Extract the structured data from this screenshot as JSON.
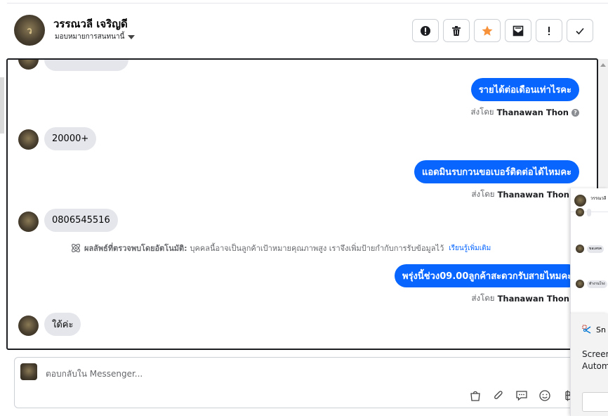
{
  "header": {
    "name": "วรรณวลี เจริญดี",
    "assign_label": "มอบหมายการสนทนานี้",
    "avatar_text": "ว"
  },
  "actions": [
    {
      "name": "mark-spam-button",
      "icon": "alert-circle-icon"
    },
    {
      "name": "delete-button",
      "icon": "trash-icon"
    },
    {
      "name": "star-button",
      "icon": "star-icon"
    },
    {
      "name": "mark-unread-button",
      "icon": "envelope-icon"
    },
    {
      "name": "follow-up-button",
      "icon": "exclamation-icon"
    },
    {
      "name": "mark-done-button",
      "icon": "check-icon"
    }
  ],
  "messages": {
    "top_partial": "...",
    "out_1": "รายได้ต่อเดือนเท่าไรคะ",
    "sent_prefix": "ส่งโดย",
    "sender": "Thanawan Thon",
    "in_1": "20000+",
    "out_2": "แอดมินรบกวนขอเบอร์ติดต่อได้ไหมคะ",
    "in_2": "0806545516",
    "out_3": "พรุ่งนี้ช่วง09.00ลูกค้าสะดวกรับสายไหมคะ",
    "in_3": "ใด้ค่ะ"
  },
  "ai_note": {
    "title": "ผลลัพธ์ที่ตรวจพบโดยอัตโนมัติ:",
    "text": "บุคคลนี้อาจเป็นลูกค้าเป้าหมายคุณภาพสูง เราจึงเพิ่มป้ายกำกับการรับข้อมูลไว้",
    "learn_more": "เรียนรู้เพิ่มเติม"
  },
  "reply": {
    "placeholder": "ตอบกลับใน Messenger..."
  },
  "mini_panel": {
    "name": "วรรณวลี",
    "items": [
      "",
      "ขอเลขค",
      "ทำงานโรง"
    ]
  },
  "snip": {
    "title": "Sn",
    "line1": "Screer",
    "line2": "Autom"
  },
  "colors": {
    "accent": "#0866ff",
    "star": "#f7923b",
    "incoming_bubble": "#e4e6eb"
  }
}
